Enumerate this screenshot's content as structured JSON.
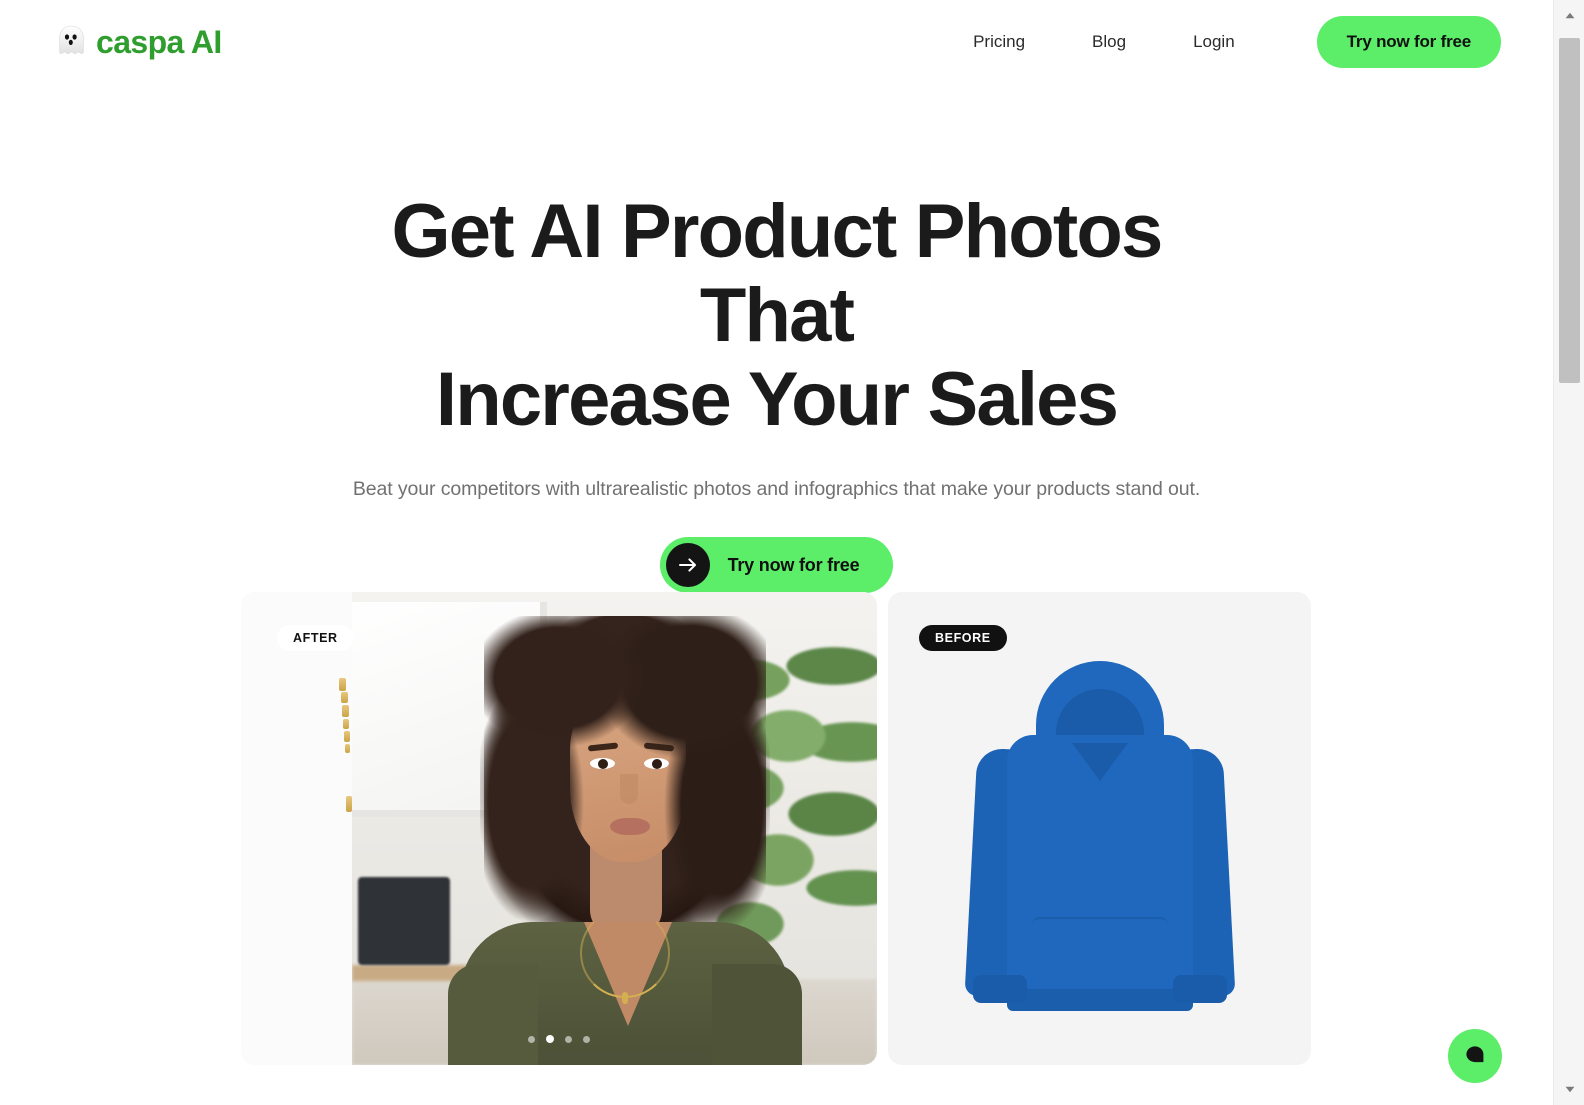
{
  "brand": {
    "name": "caspa AI",
    "icon": "ghost-icon",
    "color": "#2f9e2f"
  },
  "header": {
    "nav_links": [
      {
        "label": "Pricing"
      },
      {
        "label": "Blog"
      },
      {
        "label": "Login"
      }
    ],
    "cta_label": "Try now for free"
  },
  "hero": {
    "title_line_1": "Get AI Product Photos That",
    "title_line_2": "Increase Your Sales",
    "subtitle": "Beat your competitors with ultrarealistic photos and infographics that make your products stand out.",
    "cta_label": "Try now for free",
    "cta_icon": "arrow-right-icon"
  },
  "showcase": {
    "after_card": {
      "badge": "AFTER",
      "badge_bg": "#ffffff",
      "badge_color": "#111111",
      "image_alt": "woman wearing olive v-neck t-shirt with gold necklace in bright room"
    },
    "before_card": {
      "badge": "BEFORE",
      "badge_bg": "#111111",
      "badge_color": "#ffffff",
      "image_alt": "plain blue hoodie product shot on white background",
      "product_color": "#1f68bd"
    },
    "carousel_dots": [
      {
        "active": false
      },
      {
        "active": true
      },
      {
        "active": false
      },
      {
        "active": false
      }
    ]
  },
  "chat": {
    "icon": "chat-bubble-icon",
    "bg": "#5cee69"
  },
  "scrollbar": {
    "up_icon": "chevron-up-icon",
    "down_icon": "chevron-down-icon"
  },
  "theme": {
    "accent_green": "#5cee69",
    "brand_green": "#2f9e2f",
    "text_dark": "#1b1b1b",
    "text_muted": "#717171",
    "card_bg": "#f4f4f4"
  }
}
